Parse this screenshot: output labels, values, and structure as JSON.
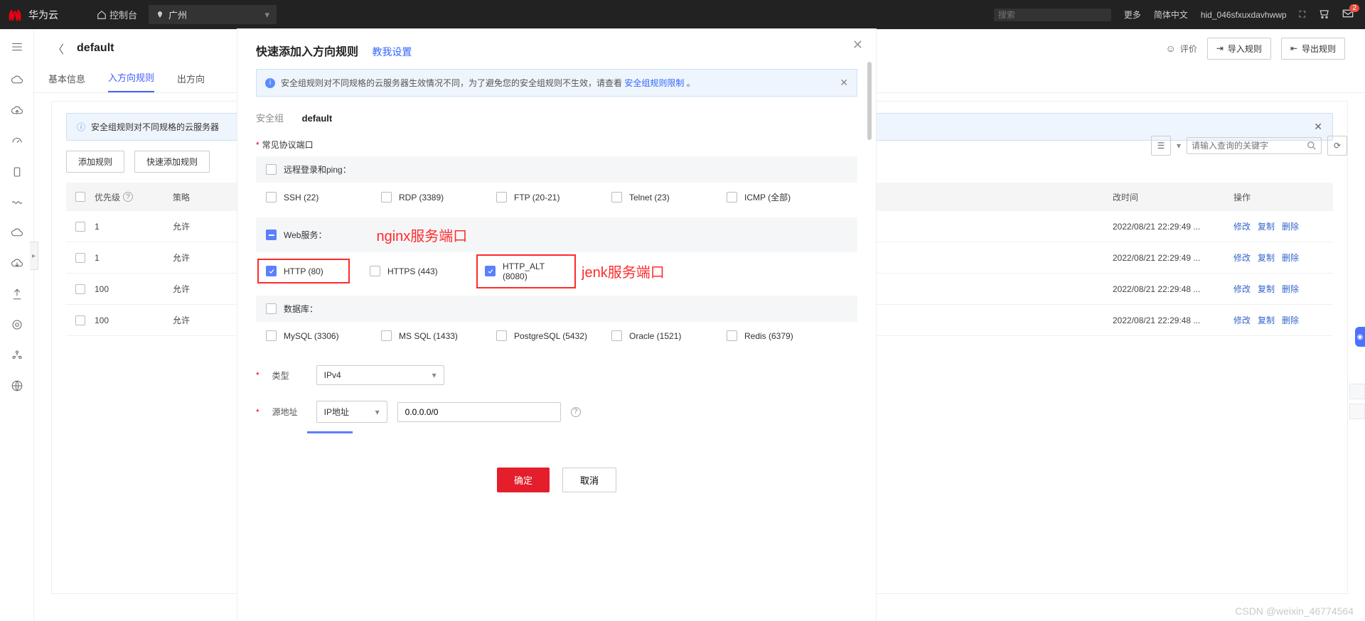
{
  "nav": {
    "brand": "华为云",
    "console": "控制台",
    "region": "广州",
    "search_placeholder": "搜索",
    "more": "更多",
    "lang": "简体中文",
    "user": "hid_046sfxuxdavhwwp",
    "mail_badge": "2"
  },
  "sub": {
    "title": "default",
    "rate": "评价",
    "import": "导入规则",
    "export": "导出规则"
  },
  "tabs": {
    "t1": "基本信息",
    "t2": "入方向规则",
    "t3": "出方向"
  },
  "panel": {
    "alert_text": "安全组规则对不同规格的云服务器",
    "add_rule": "添加规则",
    "quick_add": "快速添加规则",
    "col_priority": "优先级",
    "col_policy": "策略",
    "col_time": "改时间",
    "col_ops": "操作",
    "search_placeholder": "请输入查询的关键字",
    "rows": [
      {
        "pri": "1",
        "pol": "允许",
        "time": "2022/08/21 22:29:49 ..."
      },
      {
        "pri": "1",
        "pol": "允许",
        "time": "2022/08/21 22:29:49 ..."
      },
      {
        "pri": "100",
        "pol": "允许",
        "time": "2022/08/21 22:29:48 ..."
      },
      {
        "pri": "100",
        "pol": "允许",
        "time": "2022/08/21 22:29:48 ..."
      }
    ],
    "op_modify": "修改",
    "op_copy": "复制",
    "op_delete": "删除"
  },
  "modal": {
    "title": "快速添加入方向规则",
    "help": "教我设置",
    "alert_pre": "安全组规则对不同规格的云服务器生效情况不同，为了避免您的安全组规则不生效，请查看 ",
    "alert_link": "安全组规则限制",
    "alert_post": " 。",
    "sg_label": "安全组",
    "sg_value": "default",
    "ports_label": "常见协议端口",
    "g_login": "远程登录和ping：",
    "p_ssh": "SSH (22)",
    "p_rdp": "RDP (3389)",
    "p_ftp": "FTP (20-21)",
    "p_telnet": "Telnet (23)",
    "p_icmp": "ICMP (全部)",
    "g_web": "Web服务：",
    "p_http": "HTTP (80)",
    "p_https": "HTTPS (443)",
    "p_httpalt": "HTTP_ALT (8080)",
    "ann_nginx": "nginx服务端口",
    "ann_jenk": "jenk服务端口",
    "g_db": "数据库：",
    "p_mysql": "MySQL (3306)",
    "p_mssql": "MS SQL (1433)",
    "p_pg": "PostgreSQL (5432)",
    "p_oracle": "Oracle (1521)",
    "p_redis": "Redis (6379)",
    "f_type": "类型",
    "v_type": "IPv4",
    "f_src": "源地址",
    "v_src_mode": "IP地址",
    "v_src_val": "0.0.0.0/0",
    "ok": "确定",
    "cancel": "取消"
  },
  "wm": "CSDN @weixin_46774564"
}
